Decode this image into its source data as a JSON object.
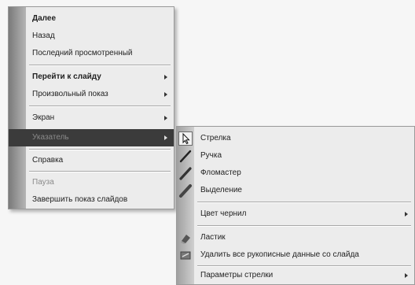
{
  "main_menu": {
    "items": [
      {
        "label": "Далее",
        "bold": true
      },
      {
        "label": "Назад"
      },
      {
        "label": "Последний просмотренный"
      },
      {
        "label": "Перейти к слайду",
        "bold": true
      },
      {
        "label": "Произвольный показ"
      },
      {
        "label": "Экран"
      },
      {
        "label": "Указатель"
      },
      {
        "label": "Справка"
      },
      {
        "label": "Пауза"
      },
      {
        "label": "Завершить показ слайдов"
      }
    ]
  },
  "sub_menu": {
    "items": [
      {
        "label": "Стрелка"
      },
      {
        "label": "Ручка"
      },
      {
        "label": "Фломастер"
      },
      {
        "label": "Выделение"
      },
      {
        "label": "Цвет чернил"
      },
      {
        "label": "Ластик"
      },
      {
        "label": "Удалить все рукописные данные со слайда"
      },
      {
        "label": "Параметры стрелки"
      }
    ]
  },
  "icons": {
    "arrow": "arrow-pointer-icon",
    "pen": "pen-icon",
    "felt_tip": "felt-tip-pen-icon",
    "highlighter": "highlighter-icon",
    "eraser": "eraser-icon",
    "erase_all": "erase-all-ink-icon",
    "submenu": "chevron-right-icon"
  },
  "colors": {
    "menu_bg": "#ececec",
    "highlight_bg": "#3b3b3b",
    "rail": "#8a8a8a"
  }
}
